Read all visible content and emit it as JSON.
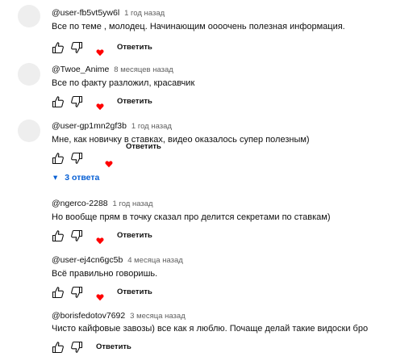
{
  "comments": [
    {
      "author": "@user-fb5vt5yw6l",
      "time": "1 год назад",
      "text": "Все по теме , молодец. Начинающим оооочень полезная информация.",
      "reply_label": "Ответить",
      "has_avatar": true
    },
    {
      "author": "@Twoe_Anime",
      "time": "8 месяцев назад",
      "text": "Все по факту разложил, красавчик",
      "reply_label": "Ответить",
      "has_avatar": true
    },
    {
      "author": "@user-gp1mn2gf3b",
      "time": "1 год назад",
      "text": "Мне, как новичку в ставках, видео оказалось супер полезным)",
      "reply_label": "Ответить",
      "has_avatar": true
    },
    {
      "author": "@ngerco-2288",
      "time": "1 год назад",
      "text": "Но вообще прям в точку сказал про делится секретами  по ставкам)",
      "reply_label": "Ответить",
      "has_avatar": false
    },
    {
      "author": "@user-ej4cn6gc5b",
      "time": "4 месяца назад",
      "text": "Всё правильно говоришь.",
      "reply_label": "Ответить",
      "has_avatar": false
    },
    {
      "author": "@borisfedotov7692",
      "time": "3 месяца назад",
      "text": "Чисто кайфовые завозы) все как я люблю. Почаще делай такие видоски бро",
      "reply_label": "Ответить",
      "has_avatar": false
    }
  ],
  "replies_toggle": {
    "chevron": "▾",
    "label": "3 ответа"
  },
  "colors": {
    "heart": "#ff0000",
    "link": "#065fd4",
    "avatar": "#eeeeee"
  },
  "icons": {
    "like": "thumb-up-icon",
    "dislike": "thumb-down-icon",
    "heart": "heart-icon"
  }
}
